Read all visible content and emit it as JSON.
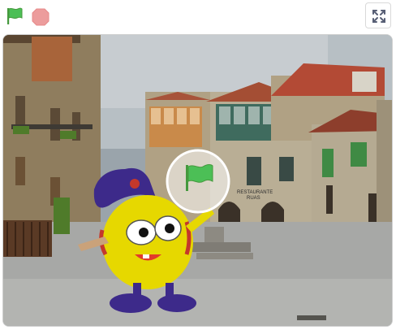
{
  "controls": {
    "green_flag_icon": "green-flag-icon",
    "stop_icon": "stop-icon",
    "fullscreen_icon": "fullscreen-icon"
  },
  "stage": {
    "backdrop_icon": "town-square-backdrop",
    "sprite_icon": "gobo-sprite",
    "overlay_icon": "green-flag-overlay-icon",
    "sign_text": "RESTAURANTE\nRUAS"
  },
  "colors": {
    "flag_green": "#4cbf56",
    "stop_red": "#ec9c9c",
    "sprite_yellow": "#e6d800",
    "hat_purple": "#3d2a8a"
  }
}
